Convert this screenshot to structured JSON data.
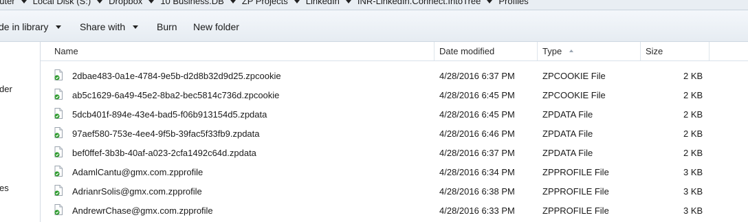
{
  "address_bar": {
    "crumbs": [
      "puter",
      "Local Disk (S:)",
      "Dropbox",
      "10 Business.DB",
      "ZP Projects",
      "LinkedIn",
      "INR-LinkedIn.Connect.IntoTree",
      "Profiles"
    ]
  },
  "toolbar": {
    "include_in_library": "de in library",
    "share_with": "Share with",
    "burn": "Burn",
    "new_folder": "New folder"
  },
  "nav_pane": {
    "items": [
      "der",
      "es"
    ]
  },
  "columns": {
    "name": "Name",
    "date_modified": "Date modified",
    "type": "Type",
    "size": "Size"
  },
  "files": [
    {
      "name": "2dbae483-0a1e-4784-9e5b-d2d8b32d9d25.zpcookie",
      "date": "4/28/2016 6:37 PM",
      "type": "ZPCOOKIE File",
      "size": "2 KB"
    },
    {
      "name": "ab5c1629-6a49-45e2-8ba2-bec5814c736d.zpcookie",
      "date": "4/28/2016 6:45 PM",
      "type": "ZPCOOKIE File",
      "size": "2 KB"
    },
    {
      "name": "5dcb401f-894e-43e4-bad5-f06b913154d5.zpdata",
      "date": "4/28/2016 6:45 PM",
      "type": "ZPDATA File",
      "size": "2 KB"
    },
    {
      "name": "97aef580-753e-4ee4-9f5b-39fac5f33fb9.zpdata",
      "date": "4/28/2016 6:46 PM",
      "type": "ZPDATA File",
      "size": "2 KB"
    },
    {
      "name": "bef0ffef-3b3b-40af-a023-2cfa1492c64d.zpdata",
      "date": "4/28/2016 6:37 PM",
      "type": "ZPDATA File",
      "size": "2 KB"
    },
    {
      "name": "AdamlCantu@gmx.com.zpprofile",
      "date": "4/28/2016 6:34 PM",
      "type": "ZPPROFILE File",
      "size": "3 KB"
    },
    {
      "name": "AdrianrSolis@gmx.com.zpprofile",
      "date": "4/28/2016 6:38 PM",
      "type": "ZPPROFILE File",
      "size": "3 KB"
    },
    {
      "name": "AndrewrChase@gmx.com.zpprofile",
      "date": "4/28/2016 6:33 PM",
      "type": "ZPPROFILE File",
      "size": "3 KB"
    }
  ],
  "colors": {
    "toolbar_bg": "#e9eef3",
    "sync_badge": "#2e9b2e"
  },
  "icons": {
    "file": "document-icon",
    "sync": "green-check-sync-icon",
    "sort": "sort-ascending-icon"
  }
}
